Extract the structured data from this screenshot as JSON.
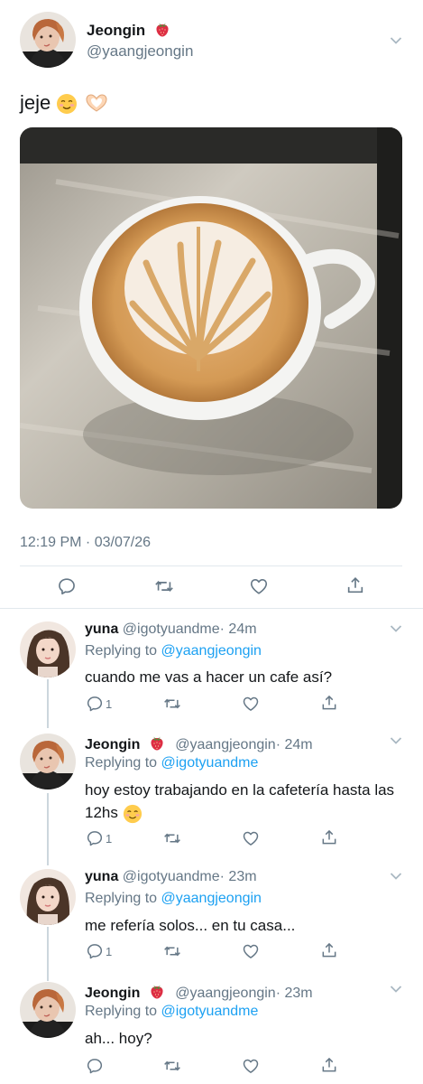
{
  "main_tweet": {
    "author_name": "Jeongin",
    "author_handle": "@yaangjeongin",
    "text": "jeje",
    "timestamp": "12:19 PM · 03/07/26",
    "icons": [
      "avatar",
      "strawberry-icon",
      "chevron-down-icon",
      "smiling-emoji-icon",
      "heart-hands-emoji-icon",
      "latte-photo"
    ],
    "actions": [
      "reply-icon",
      "retweet-icon",
      "like-icon",
      "share-icon"
    ]
  },
  "replies": [
    {
      "name": "yuna",
      "handle": "@igotyuandme",
      "time": "· 24m",
      "replying_prefix": "Replying to",
      "replying_to": "@yaangjeongin",
      "text": "cuando me vas a hacer un cafe así?",
      "reply_count": "1",
      "has_strawberry": false
    },
    {
      "name": "Jeongin",
      "handle": "@yaangjeongin",
      "time": "· 24m",
      "replying_prefix": "Replying to",
      "replying_to": "@igotyuandme",
      "text": "hoy estoy trabajando en la cafetería hasta las 12hs",
      "reply_count": "1",
      "has_strawberry": true
    },
    {
      "name": "yuna",
      "handle": "@igotyuandme",
      "time": "· 23m",
      "replying_prefix": "Replying to",
      "replying_to": "@yaangjeongin",
      "text": "me refería solos... en tu casa...",
      "reply_count": "1",
      "has_strawberry": false
    },
    {
      "name": "Jeongin",
      "handle": "@yaangjeongin",
      "time": "· 23m",
      "replying_prefix": "Replying to",
      "replying_to": "@igotyuandme",
      "text": "ah... hoy?",
      "reply_count": "",
      "has_strawberry": true
    }
  ],
  "colors": {
    "text": "#14171a",
    "secondary": "#657786",
    "link": "#1da1f2",
    "divider": "#e1e8ed",
    "thread_line": "#ccd6dd"
  }
}
